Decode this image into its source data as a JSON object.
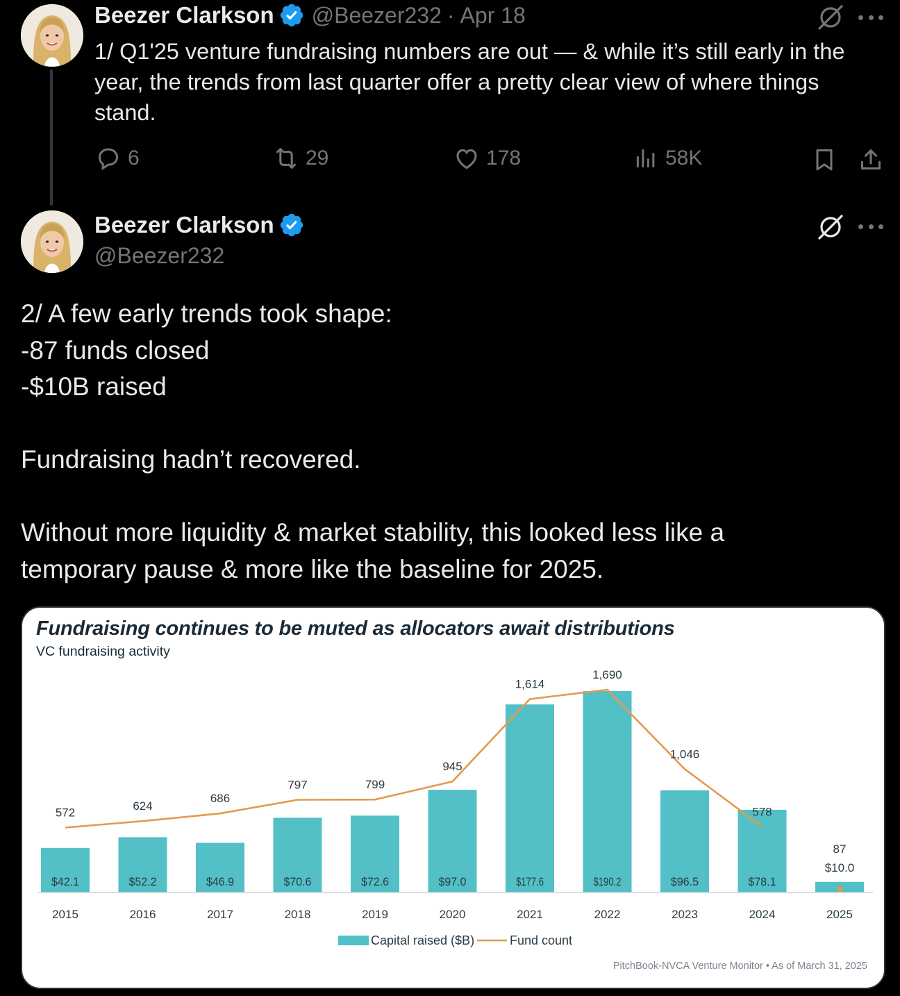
{
  "tweet1": {
    "display_name": "Beezer Clarkson",
    "handle": "@Beezer232",
    "separator": "·",
    "date": "Apr 18",
    "text": "1/ Q1'25 venture fundraising numbers are out — & while it’s still early in the year, the trends from last quarter offer a pretty clear view of where things stand.",
    "replies": "6",
    "reposts": "29",
    "likes": "178",
    "views": "58K"
  },
  "tweet2": {
    "display_name": "Beezer Clarkson",
    "handle": "@Beezer232",
    "text": "2/ A few early trends took shape:\n-87 funds closed\n-$10B raised\n\nFundraising hadn’t recovered.\n\nWithout more liquidity & market stability, this looked less like a\ntemporary pause & more like the baseline for 2025."
  },
  "icons": {
    "verified": "verified-badge-icon",
    "grok": "grok-icon",
    "more": "more-icon",
    "reply": "reply-icon",
    "repost": "repost-icon",
    "like": "like-icon",
    "views": "views-icon",
    "bookmark": "bookmark-icon",
    "share": "share-icon"
  },
  "colors": {
    "background": "#000000",
    "text": "#e7e9ea",
    "muted": "#71767b",
    "verified": "#1d9bf0",
    "bar": "#52c0c6",
    "line": "#e39a4f"
  },
  "chart_data": {
    "type": "bar",
    "title": "Fundraising continues to be muted as allocators await distributions",
    "subtitle": "VC fundraising activity",
    "categories": [
      "2015",
      "2016",
      "2017",
      "2018",
      "2019",
      "2020",
      "2021",
      "2022",
      "2023",
      "2024",
      "2025"
    ],
    "series": [
      {
        "name": "Capital raised ($B)",
        "type": "bar",
        "values": [
          42.1,
          52.2,
          46.9,
          70.6,
          72.6,
          97.0,
          177.6,
          190.2,
          96.5,
          78.1,
          10.0
        ],
        "labels": [
          "$42.1",
          "$52.2",
          "$46.9",
          "$70.6",
          "$72.6",
          "$97.0",
          "$177.6",
          "$190.2",
          "$96.5",
          "$78.1",
          "$10.0"
        ]
      },
      {
        "name": "Fund count",
        "type": "line",
        "values": [
          572,
          624,
          686,
          797,
          799,
          945,
          1614,
          1690,
          1046,
          578,
          87
        ],
        "labels": [
          "572",
          "624",
          "686",
          "797",
          "799",
          "945",
          "1,614",
          "1,690",
          "1,046",
          "578",
          "87"
        ]
      }
    ],
    "legend_position": "bottom-center",
    "grid": false,
    "source": "PitchBook-NVCA Venture Monitor  •  As of March 31, 2025"
  }
}
